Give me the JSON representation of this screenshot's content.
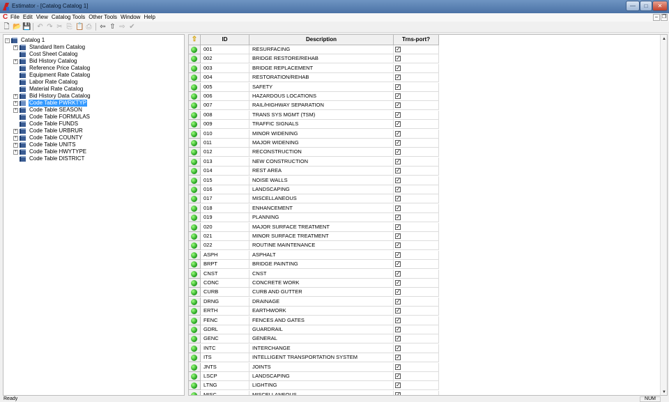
{
  "window": {
    "title": "Estimator - [Catalog Catalog 1]",
    "minimize_glyph": "—",
    "maximize_glyph": "□",
    "close_glyph": "✕"
  },
  "menubar": {
    "items": [
      "File",
      "Edit",
      "View",
      "Catalog Tools",
      "Other Tools",
      "Window",
      "Help"
    ],
    "mdi_minimize": "–",
    "mdi_restore": "❐"
  },
  "toolbar": {
    "icons": [
      "new-icon",
      "open-icon",
      "save-icon",
      "undo-icon",
      "redo-icon",
      "cut-icon",
      "copy-icon",
      "paste-icon",
      "print-icon",
      "back-icon",
      "up-icon",
      "forward-icon",
      "check-icon"
    ]
  },
  "tree": {
    "root": "Catalog 1",
    "items": [
      {
        "label": "Standard Item Catalog",
        "expandable": true
      },
      {
        "label": "Cost Sheet Catalog",
        "expandable": false
      },
      {
        "label": "Bid History Catalog",
        "expandable": true
      },
      {
        "label": "Reference Price Catalog",
        "expandable": false
      },
      {
        "label": "Equipment Rate Catalog",
        "expandable": false
      },
      {
        "label": "Labor Rate Catalog",
        "expandable": false
      },
      {
        "label": "Material Rate Catalog",
        "expandable": false
      },
      {
        "label": "Bid History Data Catalog",
        "expandable": true
      },
      {
        "label": "Code Table PWRKTYP",
        "expandable": true,
        "selected": true
      },
      {
        "label": "Code Table SEASON",
        "expandable": true
      },
      {
        "label": "Code Table FORMULAS",
        "expandable": false
      },
      {
        "label": "Code Table FUNDS",
        "expandable": false
      },
      {
        "label": "Code Table URBRUR",
        "expandable": true
      },
      {
        "label": "Code Table COUNTY",
        "expandable": true
      },
      {
        "label": "Code Table UNITS",
        "expandable": true
      },
      {
        "label": "Code Table HWYTYPE",
        "expandable": true
      },
      {
        "label": "Code Table DISTRICT",
        "expandable": false
      }
    ]
  },
  "grid": {
    "columns": [
      "ID",
      "Description",
      "Trns-port?"
    ],
    "rows": [
      {
        "id": "001",
        "desc": "RESURFACING",
        "trnsport": true
      },
      {
        "id": "002",
        "desc": "BRIDGE RESTORE/REHAB",
        "trnsport": true
      },
      {
        "id": "003",
        "desc": "BRIDGE REPLACEMENT",
        "trnsport": true
      },
      {
        "id": "004",
        "desc": "RESTORATION/REHAB",
        "trnsport": true
      },
      {
        "id": "005",
        "desc": "SAFETY",
        "trnsport": true
      },
      {
        "id": "006",
        "desc": "HAZARDOUS LOCATIONS",
        "trnsport": true
      },
      {
        "id": "007",
        "desc": "RAIL/HIGHWAY SEPARATION",
        "trnsport": true
      },
      {
        "id": "008",
        "desc": "TRANS SYS MGMT (TSM)",
        "trnsport": true
      },
      {
        "id": "009",
        "desc": "TRAFFIC SIGNALS",
        "trnsport": true
      },
      {
        "id": "010",
        "desc": "MINOR WIDENING",
        "trnsport": true
      },
      {
        "id": "011",
        "desc": "MAJOR WIDENING",
        "trnsport": true
      },
      {
        "id": "012",
        "desc": "RECONSTRUCTION",
        "trnsport": true
      },
      {
        "id": "013",
        "desc": "NEW CONSTRUCTION",
        "trnsport": true
      },
      {
        "id": "014",
        "desc": "REST AREA",
        "trnsport": true
      },
      {
        "id": "015",
        "desc": "NOISE WALLS",
        "trnsport": true
      },
      {
        "id": "016",
        "desc": "LANDSCAPING",
        "trnsport": true
      },
      {
        "id": "017",
        "desc": "MISCELLANEOUS",
        "trnsport": true
      },
      {
        "id": "018",
        "desc": "ENHANCEMENT",
        "trnsport": true
      },
      {
        "id": "019",
        "desc": "PLANNING",
        "trnsport": true
      },
      {
        "id": "020",
        "desc": "MAJOR SURFACE TREATMENT",
        "trnsport": true
      },
      {
        "id": "021",
        "desc": "MINOR SURFACE TREATMENT",
        "trnsport": true
      },
      {
        "id": "022",
        "desc": "ROUTINE MAINTENANCE",
        "trnsport": true
      },
      {
        "id": "ASPH",
        "desc": "ASPHALT",
        "trnsport": true
      },
      {
        "id": "BRPT",
        "desc": "BRIDGE PAINTING",
        "trnsport": true
      },
      {
        "id": "CNST",
        "desc": "CNST",
        "trnsport": true
      },
      {
        "id": "CONC",
        "desc": "CONCRETE WORK",
        "trnsport": true
      },
      {
        "id": "CURB",
        "desc": "CURB AND GUTTER",
        "trnsport": true
      },
      {
        "id": "DRNG",
        "desc": "DRAINAGE",
        "trnsport": true
      },
      {
        "id": "ERTH",
        "desc": "EARTHWORK",
        "trnsport": true
      },
      {
        "id": "FENC",
        "desc": "FENCES AND GATES",
        "trnsport": true
      },
      {
        "id": "GDRL",
        "desc": "GUARDRAIL",
        "trnsport": true
      },
      {
        "id": "GENC",
        "desc": "GENERAL",
        "trnsport": true
      },
      {
        "id": "INTC",
        "desc": "INTERCHANGE",
        "trnsport": true
      },
      {
        "id": "ITS",
        "desc": "INTELLIGENT TRANSPORTATION SYSTEM",
        "trnsport": true
      },
      {
        "id": "JNTS",
        "desc": "JOINTS",
        "trnsport": true
      },
      {
        "id": "LSCP",
        "desc": "LANDSCAPING",
        "trnsport": true
      },
      {
        "id": "LTNG",
        "desc": "LIGHTING",
        "trnsport": true
      },
      {
        "id": "MISC",
        "desc": "MISCELLANEOUS",
        "trnsport": true
      }
    ]
  },
  "statusbar": {
    "status": "Ready",
    "num": "NUM"
  },
  "colors": {
    "selection": "#3399ff",
    "status_dot": "#1c9a18",
    "title_gradient": "#5a80b4"
  }
}
